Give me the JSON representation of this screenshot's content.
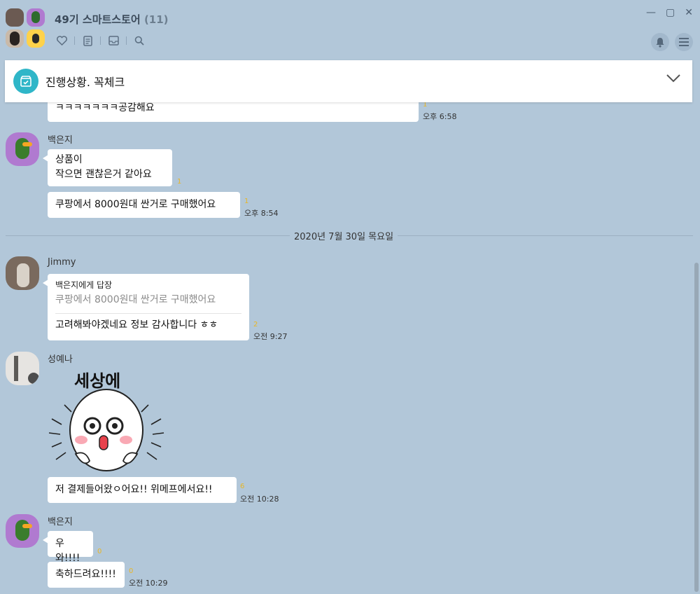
{
  "header": {
    "title": "49기 스마트스토어",
    "member_count": "(11)"
  },
  "notice": {
    "text": "진행상황. 꼭체크",
    "icon": "box-check-icon"
  },
  "colors": {
    "background": "#b2c7d9",
    "bubble": "#ffffff",
    "unread": "#e8b626",
    "notice_icon": "#2fb6c8"
  },
  "messages": {
    "m0": {
      "text": "ㅋㅋㅋㅋㅋㅋㅋ공감해요",
      "unread": "1",
      "time": "오후 6:58"
    },
    "baek1": {
      "name": "백은지",
      "b1_line1": "상품이",
      "b1_line2": "작으면 괜찮은거 같아요",
      "b1_unread": "1",
      "b2": "쿠팡에서 8000원대 싼거로 구매했어요",
      "b2_unread": "1",
      "time": "오후 8:54"
    },
    "date_divider": "2020년 7월 30일 목요일",
    "jimmy": {
      "name": "Jimmy",
      "reply_to": "백은지에게 답장",
      "quote": "쿠팡에서 8000원대 싼거로 구매했어요",
      "text": "고려해봐야겠네요 정보 감사합니다 ㅎㅎ",
      "unread": "2",
      "time": "오전 9:27"
    },
    "seong": {
      "name": "성예나",
      "sticker_text": "세상에",
      "text": "저 결제들어왔ㅇ어요!! 위메프에서요!!",
      "unread": "6",
      "time": "오전 10:28"
    },
    "baek2": {
      "name": "백은지",
      "b1": "우와!!!!",
      "b1_unread": "0",
      "b2": "축하드려요!!!!",
      "b2_unread": "0",
      "time": "오전 10:29"
    }
  }
}
